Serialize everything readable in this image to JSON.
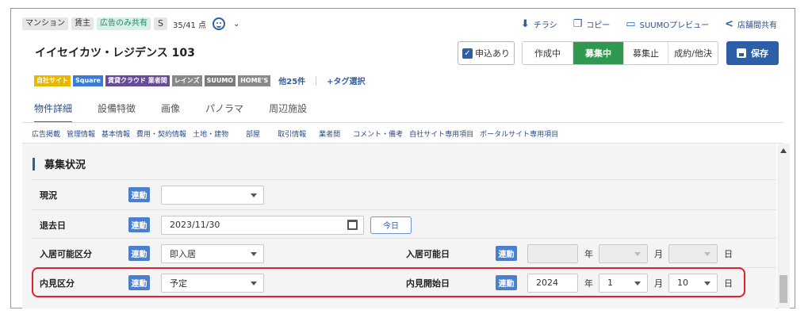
{
  "meta": {
    "tags": [
      "マンション",
      "賃主",
      "広告のみ共有"
    ],
    "s_label": "S",
    "score": "35/41 点"
  },
  "top_actions": [
    {
      "icon": "download-icon",
      "glyph": "⬇",
      "label": "チラシ"
    },
    {
      "icon": "copy-icon",
      "glyph": "❐",
      "label": "コピー"
    },
    {
      "icon": "monitor-icon",
      "glyph": "▭",
      "label": "SUUMOプレビュー"
    },
    {
      "icon": "share-icon",
      "glyph": "<",
      "label": "店舗間共有"
    }
  ],
  "property_title": "イイセイカツ・レジデンス 103",
  "status": {
    "apply_checkbox_label": "申込あり",
    "segments": [
      "作成中",
      "募集中",
      "募集止",
      "成約/他決"
    ],
    "active_segment": "募集中",
    "save_label": "保存"
  },
  "site_tags": [
    {
      "label": "自社サイト",
      "color": "#e8b800"
    },
    {
      "label": "Square",
      "color": "#3a7bd5"
    },
    {
      "label": "賃貸クラウド 業者間",
      "color": "#6b4a9c"
    },
    {
      "label": "レインズ",
      "color": "#888888"
    },
    {
      "label": "SUUMO",
      "color": "#7a7a7a"
    },
    {
      "label": "HOME'S",
      "color": "#8a8a8a"
    }
  ],
  "site_more": "他25件",
  "tag_select": "+タグ選択",
  "tabs": [
    "物件詳細",
    "設備特徴",
    "画像",
    "パノラマ",
    "周辺施設"
  ],
  "active_tab": "物件詳細",
  "subnav": [
    "広告掲載",
    "管理情報",
    "基本情報",
    "費用・契約情報",
    "土地・建物",
    "部屋",
    "取引情報",
    "業者間",
    "コメント・備考",
    "自社サイト専用項目",
    "ポータルサイト専用項目"
  ],
  "section_title": "募集状況",
  "link_badge": "連動",
  "rows": {
    "genkyo": {
      "label": "現況",
      "value": ""
    },
    "taikyo": {
      "label": "退去日",
      "value": "2023/11/30",
      "today_button": "今日"
    },
    "nyukyo_kubun": {
      "label": "入居可能区分",
      "value": "即入居"
    },
    "nyukyo_date": {
      "label": "入居可能日",
      "year": "",
      "month": "",
      "day": ""
    },
    "naiken_kubun": {
      "label": "内見区分",
      "value": "予定"
    },
    "naiken_date": {
      "label": "内見開始日",
      "year": "2024",
      "month": "1",
      "day": "10"
    }
  },
  "units": {
    "year": "年",
    "month": "月",
    "day": "日"
  },
  "colors": {
    "accent": "#2c5fa8",
    "active_green": "#2f9a4f",
    "highlight_red": "#e0202a",
    "link_badge": "#4a7fd0"
  }
}
